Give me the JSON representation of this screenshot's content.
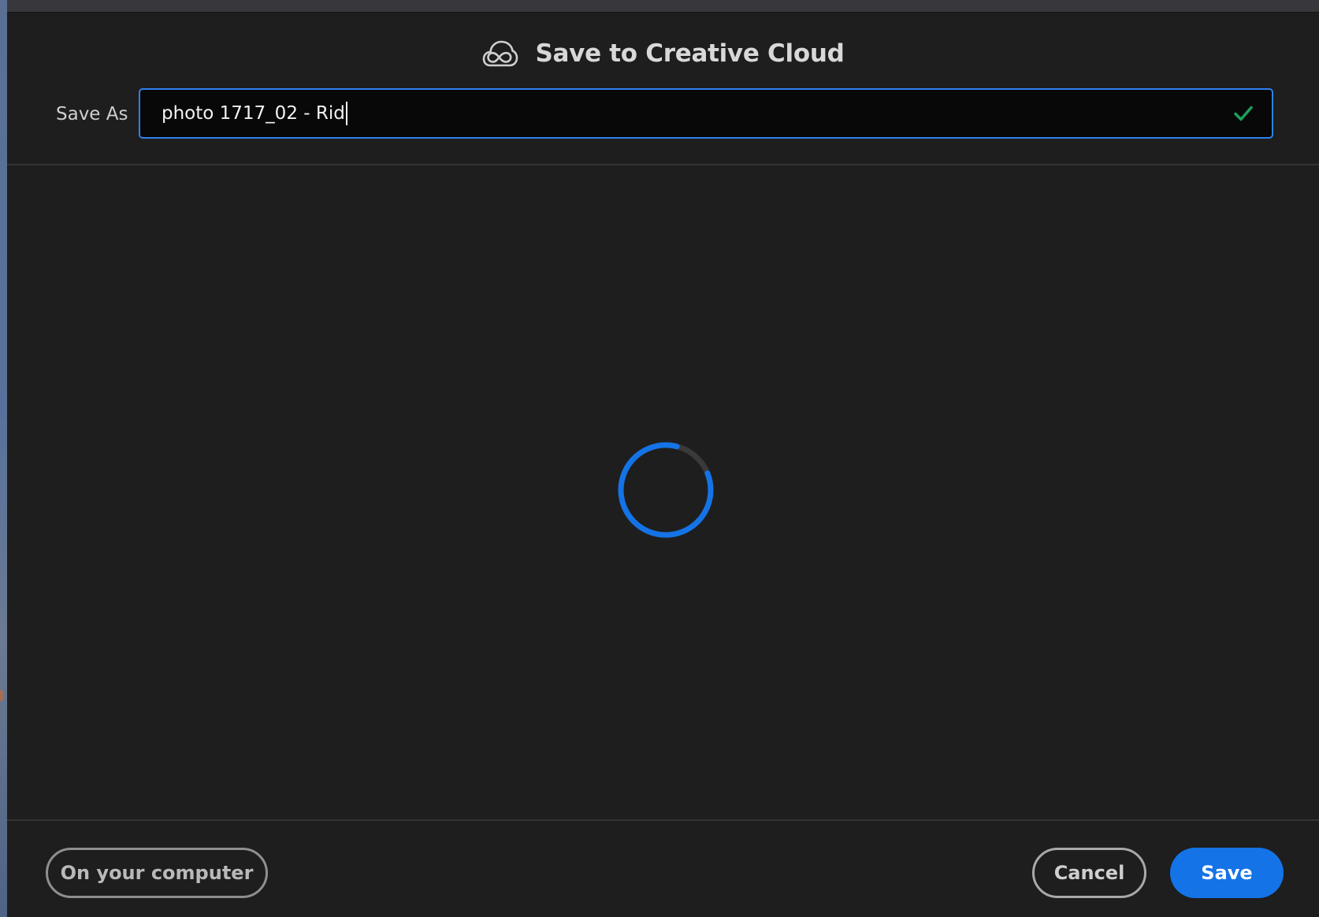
{
  "dialog": {
    "title": "Save to Creative Cloud",
    "title_icon": "creative-cloud-icon"
  },
  "save_as": {
    "label": "Save As",
    "value": "photo 1717_02 - Rid",
    "valid_icon": "checkmark-icon",
    "valid_color": "#1e9e5a"
  },
  "content": {
    "state": "loading",
    "spinner_icon": "loading-spinner-icon",
    "spinner_progress": 0.85,
    "spinner_color": "#1473e6"
  },
  "footer": {
    "computer_label": "On your computer",
    "cancel_label": "Cancel",
    "save_label": "Save"
  },
  "colors": {
    "accent": "#1473e6",
    "background": "#1e1e1e",
    "input_border": "#2f80f0"
  }
}
